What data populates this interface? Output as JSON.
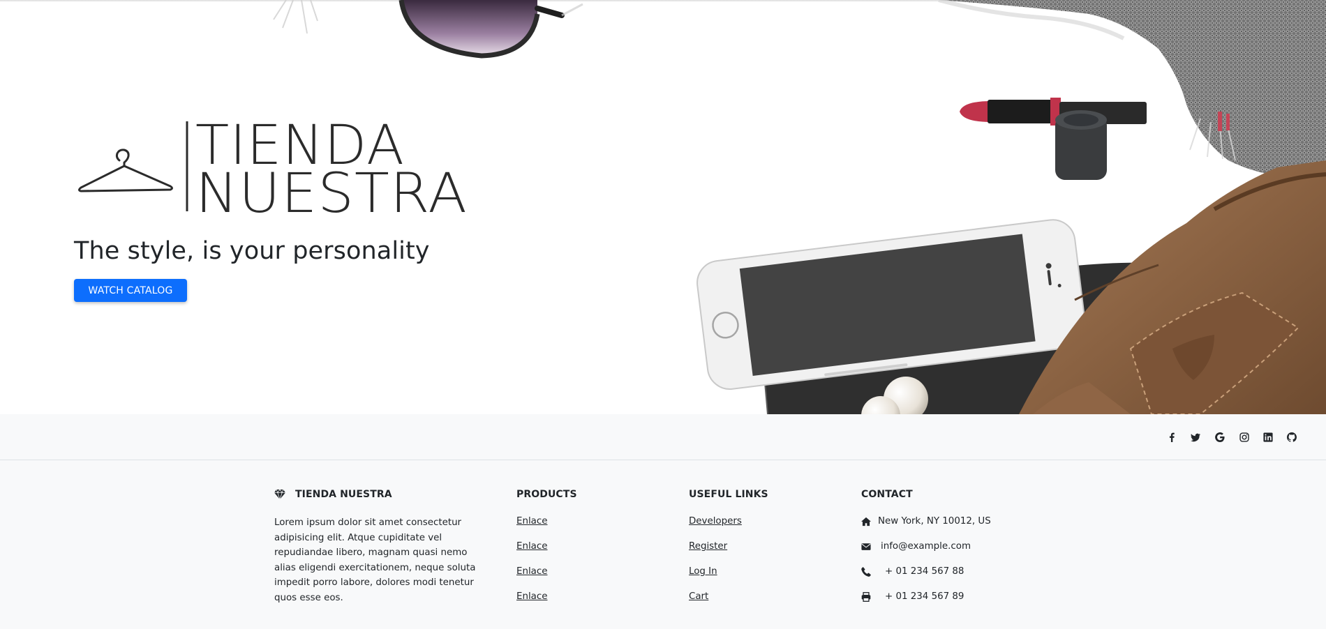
{
  "hero": {
    "logo_text_line1": "TIENDA",
    "logo_text_line2": "NUESTRA",
    "tagline": "The style, is your personality",
    "cta_label": "WATCH CATALOG"
  },
  "social": {
    "icons": [
      "facebook-icon",
      "twitter-icon",
      "google-icon",
      "instagram-icon",
      "linkedin-icon",
      "github-icon"
    ]
  },
  "footer": {
    "brand": {
      "title": "TIENDA NUESTRA",
      "icon": "gem-icon",
      "text": "Lorem ipsum dolor sit amet consectetur adipisicing elit. Atque cupiditate vel repudiandae libero, magnam quasi nemo alias eligendi exercitationem, neque soluta impedit porro labore, dolores modi tenetur quos esse eos."
    },
    "products": {
      "title": "PRODUCTS",
      "links": [
        "Enlace",
        "Enlace",
        "Enlace",
        "Enlace"
      ]
    },
    "useful": {
      "title": "USEFUL LINKS",
      "links": [
        "Developers",
        "Register",
        "Log In",
        "Cart"
      ]
    },
    "contact": {
      "title": "CONTACT",
      "address": "New York, NY 10012, US",
      "email": "info@example.com",
      "phone": "+ 01 234 567 88",
      "fax": "+ 01 234 567 89"
    }
  },
  "colors": {
    "primary": "#0d6efd",
    "text": "#212529",
    "footer_bg": "#f8f9fa",
    "border": "#dee2e6"
  }
}
